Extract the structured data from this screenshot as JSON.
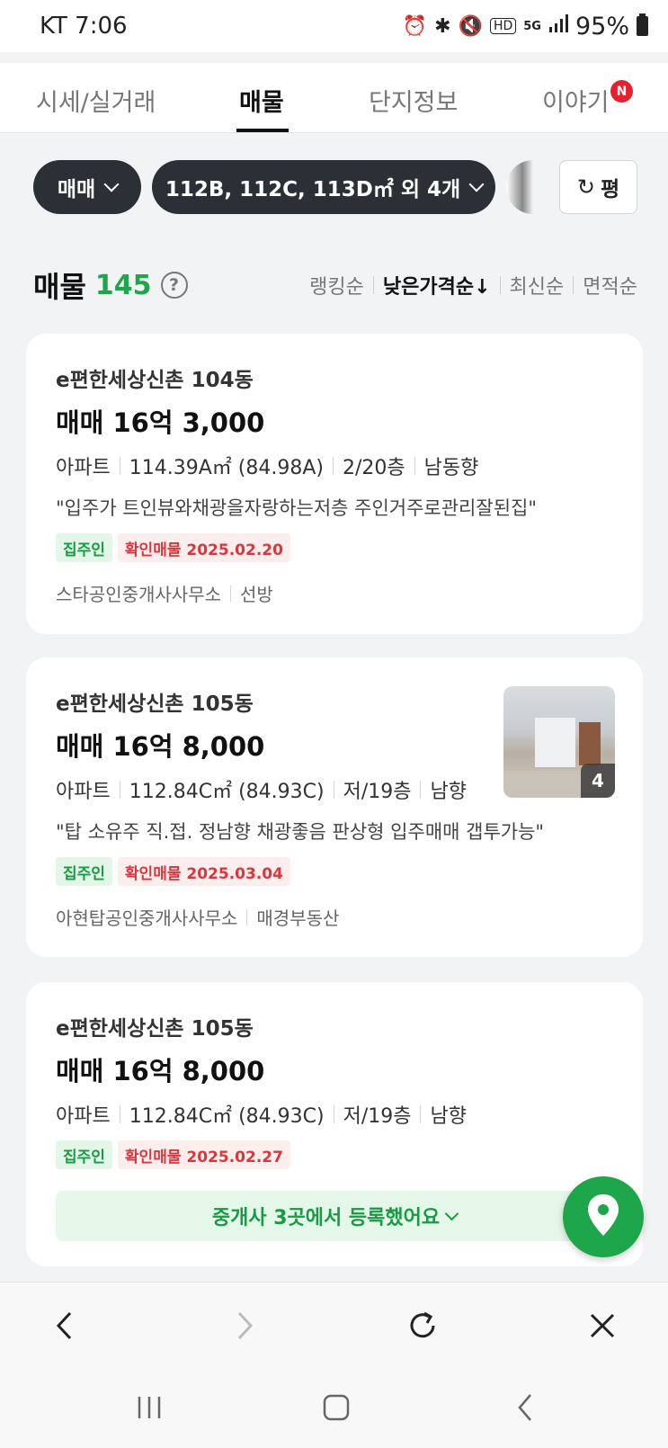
{
  "status_bar": {
    "time": "KT 7:06",
    "hd": "HD",
    "network": "5G",
    "battery": "95%"
  },
  "tabs": [
    {
      "label": "시세/실거래"
    },
    {
      "label": "매물"
    },
    {
      "label": "단지정보"
    },
    {
      "label": "이야기",
      "badge": "N"
    }
  ],
  "filters": {
    "trade_type": "매매",
    "area_filter": "112B, 112C, 113D㎡ 외 4개",
    "unit_button": "평"
  },
  "list": {
    "title": "매물",
    "count": "145",
    "help": "?",
    "sorts": [
      "랭킹순",
      "낮은가격순↓",
      "최신순",
      "면적순"
    ]
  },
  "listings": [
    {
      "complex": "e편한세상신촌 104동",
      "price": "매매 16억 3,000",
      "spec": [
        "아파트",
        "114.39A㎡ (84.98A)",
        "2/20층",
        "남동향"
      ],
      "desc": "\"입주가 트인뷰와채광을자랑하는저층 주인거주로관리잘된집\"",
      "badges": [
        "집주인",
        "확인매물 2025.02.20"
      ],
      "agency": [
        "스타공인중개사사무소",
        "선방"
      ]
    },
    {
      "complex": "e편한세상신촌 105동",
      "price": "매매 16억 8,000",
      "spec": [
        "아파트",
        "112.84C㎡ (84.93C)",
        "저/19층",
        "남향"
      ],
      "desc": "\"탑 소유주 직.접. 정남향 채광좋음 판상형 입주매매 갭투가능\"",
      "badges": [
        "집주인",
        "확인매물 2025.03.04"
      ],
      "agency": [
        "아현탑공인중개사사무소",
        "매경부동산"
      ],
      "photo_count": "4"
    },
    {
      "complex": "e편한세상신촌 105동",
      "price": "매매 16억 8,000",
      "spec": [
        "아파트",
        "112.84C㎡ (84.93C)",
        "저/19층",
        "남향"
      ],
      "badges": [
        "집주인",
        "확인매물 2025.02.27"
      ],
      "agents_bar": "중개사 3곳에서 등록했어요"
    }
  ],
  "colors": {
    "accent_green": "#1fa64a",
    "badge_red": "#e81f2f",
    "chip_dark": "#2b2f36"
  },
  "icons": [
    "alarm-icon",
    "bluetooth-icon",
    "mute-icon",
    "signal-icon",
    "battery-icon",
    "refresh-icon",
    "help-icon",
    "map-pin-icon",
    "back-icon",
    "forward-icon",
    "reload-icon",
    "close-icon",
    "recents-icon",
    "home-icon",
    "nav-back-icon"
  ]
}
